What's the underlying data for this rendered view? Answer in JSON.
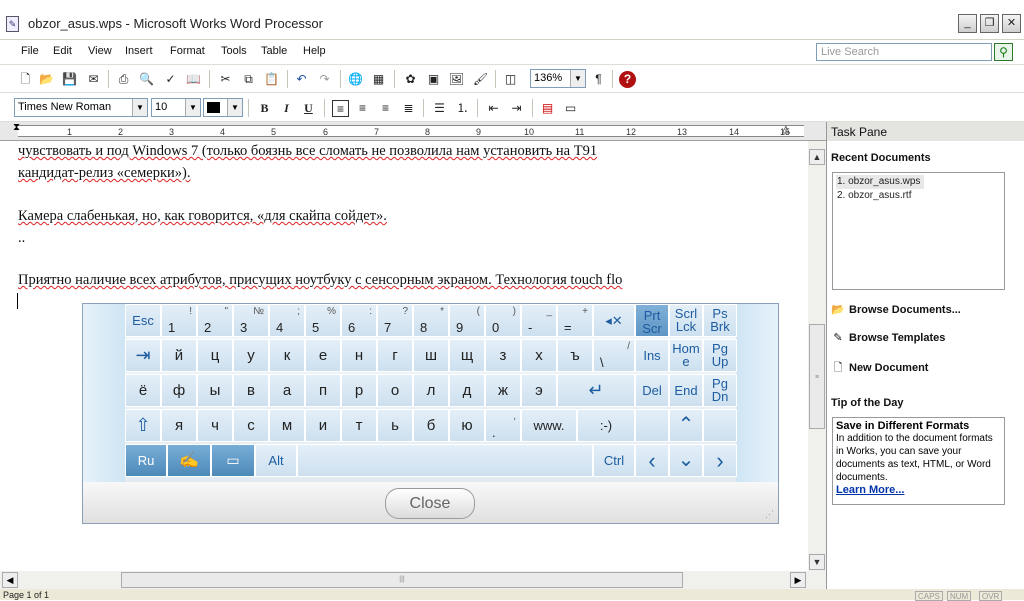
{
  "window": {
    "title": "obzor_asus.wps - Microsoft Works Word Processor",
    "min": "_",
    "restore": "❐",
    "close": "✕"
  },
  "menu": [
    "File",
    "Edit",
    "View",
    "Insert",
    "Format",
    "Tools",
    "Table",
    "Help"
  ],
  "search": {
    "placeholder": "Live Search",
    "go": "⚲"
  },
  "toolbar": {
    "zoom": "136%"
  },
  "format": {
    "font": "Times New Roman",
    "size": "10",
    "bold": "B",
    "italic": "I",
    "underline": "U"
  },
  "ruler": [
    "1",
    "2",
    "3",
    "4",
    "5",
    "6",
    "7",
    "8",
    "9",
    "10",
    "11",
    "12",
    "13",
    "14",
    "15"
  ],
  "document": {
    "lines": [
      "чувствовать и под Windows 7 (только боязнь все сломать не позволила нам установить на T91",
      "кандидат-релиз «семерки»).",
      "Камера слабенькая, но, как говорится, «для скайпа сойдет».",
      "..",
      "Приятно наличие всех атрибутов, присущих ноутбуку с сенсорным экраном. Технология touch flo"
    ]
  },
  "taskpane": {
    "title": "Task Pane",
    "recent_title": "Recent Documents",
    "recent": [
      "1. obzor_asus.wps",
      "2. obzor_asus.rtf"
    ],
    "browse_documents": "Browse Documents...",
    "browse_templates": "Browse Templates",
    "new_document": "New Document",
    "tip_title": "Tip of the Day",
    "tip_heading": "Save in Different Formats",
    "tip_body": "In addition to the document formats in Works, you can save your documents as text, HTML, or Word documents.",
    "learn_more": "Learn More..."
  },
  "keyboard": {
    "row1": [
      {
        "main": "Esc",
        "sup": ""
      },
      {
        "main": "1",
        "sup": "!"
      },
      {
        "main": "2",
        "sup": "\""
      },
      {
        "main": "3",
        "sup": "№"
      },
      {
        "main": "4",
        "sup": ";"
      },
      {
        "main": "5",
        "sup": "%"
      },
      {
        "main": "6",
        "sup": ":"
      },
      {
        "main": "7",
        "sup": "?"
      },
      {
        "main": "8",
        "sup": "*"
      },
      {
        "main": "9",
        "sup": "("
      },
      {
        "main": "0",
        "sup": ")"
      },
      {
        "main": "-",
        "sup": "_"
      },
      {
        "main": "=",
        "sup": "+"
      }
    ],
    "backspace": "◂✕",
    "prtscr": [
      "Prt",
      "Scr"
    ],
    "scrllck": [
      "Scrl",
      "Lck"
    ],
    "psbrk": [
      "Ps",
      "Brk"
    ],
    "tab": "⇥",
    "row2": [
      "й",
      "ц",
      "у",
      "к",
      "е",
      "н",
      "г",
      "ш",
      "щ",
      "з",
      "х",
      "ъ"
    ],
    "backslash": {
      "main": "\\",
      "sup": "/"
    },
    "ins": "Ins",
    "home": [
      "Hom",
      "e"
    ],
    "pgup": [
      "Pg",
      "Up"
    ],
    "row3": [
      "ё",
      "ф",
      "ы",
      "в",
      "а",
      "п",
      "р",
      "о",
      "л",
      "д",
      "ж",
      "э"
    ],
    "enter": "↵",
    "del": "Del",
    "end": "End",
    "pgdn": [
      "Pg",
      "Dn"
    ],
    "shift": "⇧",
    "row4": [
      "я",
      "ч",
      "с",
      "м",
      "и",
      "т",
      "ь",
      "б",
      "ю"
    ],
    "period": {
      "main": ".",
      "sup": ","
    },
    "www": "www.",
    "smiley": ":-)",
    "up": "⌃",
    "lang": "Ru",
    "alt": "Alt",
    "ctrl": "Ctrl",
    "left": "‹",
    "down": "⌄",
    "right": "›",
    "close": "Close"
  },
  "status": {
    "page": "Page 1 of 1",
    "caps": "CAPS",
    "num": "NUM",
    "ovr": "OVR"
  }
}
